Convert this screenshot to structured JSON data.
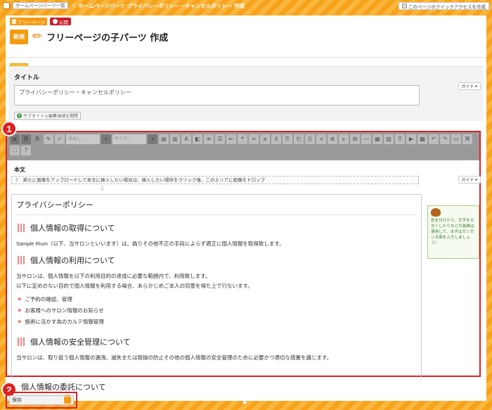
{
  "breadcrumb": {
    "home_link": "ホームページパーツ一覧",
    "current": "ホームページパーツ プライバシーポリシー・キャンセルポリシー 作成"
  },
  "quick_access": {
    "label": "このページのクイックアクセスを作成"
  },
  "header": {
    "page_badge": "フリーページ",
    "status_badge": "公開",
    "new_label": "新規",
    "title": "フリーページの子パーツ 作成"
  },
  "guide_tag": "ガイド",
  "title_section": {
    "label": "タイトル",
    "value": "プライバシーポリシー・キャンセルポリシー",
    "guide_btn": "ガイド",
    "subtitle_btn": "サブタイトル編集領域を開閉"
  },
  "editor": {
    "font_select": "見出し...",
    "size_select": "サイズ...",
    "body_label": "本文",
    "drop_hint": "新たに画像をアップロードして本文に挿入したい場合は、挿入したい場所をクリック後、このエリアに画像をドロップ",
    "guide_btn": "ガイド",
    "content": {
      "title": "プライバシーポリシー",
      "sections": [
        {
          "heading": "個人情報の取得について",
          "paras": [
            "Sample Rium（以下、当サロンといいます）は、偽りその他不正の手段によらず適正に個人情報を取得致します。"
          ],
          "list": []
        },
        {
          "heading": "個人情報の利用について",
          "paras": [
            "当サロンは、個人情報を以下の利用目的の達成に必要な範囲内で、利用致します。",
            "以下に定めのない目的で個人情報を利用する場合、あらかじめご本人の同意を得た上で行ないます。"
          ],
          "list": [
            "ご予約の確認、管理",
            "お客様へのサロン情報のお知らせ",
            "施術に活かす為のカルテ情報管理"
          ]
        },
        {
          "heading": "個人情報の安全管理について",
          "paras": [
            "当サロンは、取り扱う個人情報の漏洩、滅失または毀損の防止その他の個人情報の安全管理のために必要かつ適切な措置を講じます。"
          ],
          "list": []
        }
      ],
      "overlap_heading": "個人情報の委託について"
    },
    "help_text": "色を付けたり、文字を大きくしたりなどの装飾は適用して、まずはガンガン文章を入力しましょう！"
  },
  "markers": {
    "one": "1",
    "two": "2"
  },
  "save": {
    "label": "保存"
  }
}
